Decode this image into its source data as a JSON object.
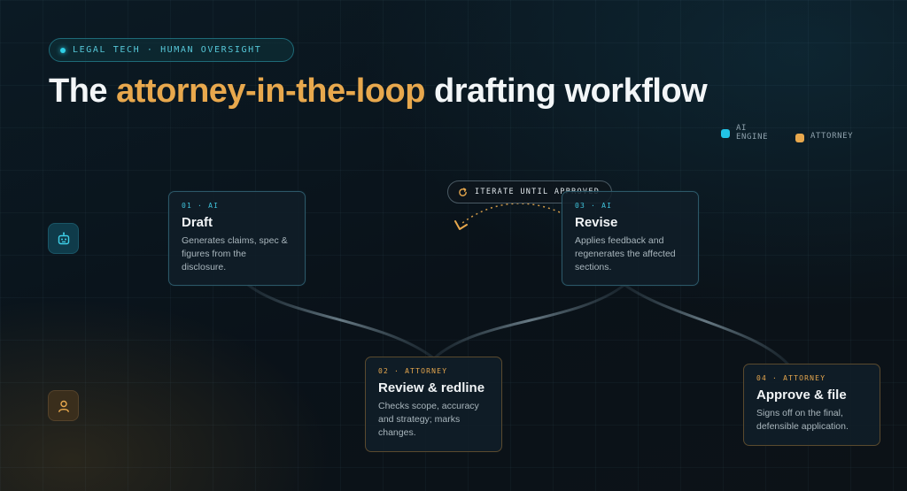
{
  "badge": "LEGAL TECH · HUMAN OVERSIGHT",
  "title": {
    "before": "The ",
    "accent": "attorney-in-the-loop",
    "after": " drafting workflow"
  },
  "legend": {
    "ai_line1": "AI",
    "ai_line2": "ENGINE",
    "attorney": "ATTORNEY"
  },
  "colors": {
    "ai": "#22c3e6",
    "attorney": "#e8a84d"
  },
  "lanes": {
    "ai_icon": "robot-icon",
    "attorney_icon": "person-icon"
  },
  "loop_label": "ITERATE UNTIL APPROVED",
  "steps": [
    {
      "step": "01 · AI",
      "title": "Draft",
      "desc": "Generates claims, spec & figures from the disclosure."
    },
    {
      "step": "02 · ATTORNEY",
      "title": "Review & redline",
      "desc": "Checks scope, accuracy and strategy; marks changes."
    },
    {
      "step": "03 · AI",
      "title": "Revise",
      "desc": "Applies feedback and regenerates the affected sections."
    },
    {
      "step": "04 · ATTORNEY",
      "title": "Approve & file",
      "desc": "Signs off on the final, defensible application."
    }
  ]
}
